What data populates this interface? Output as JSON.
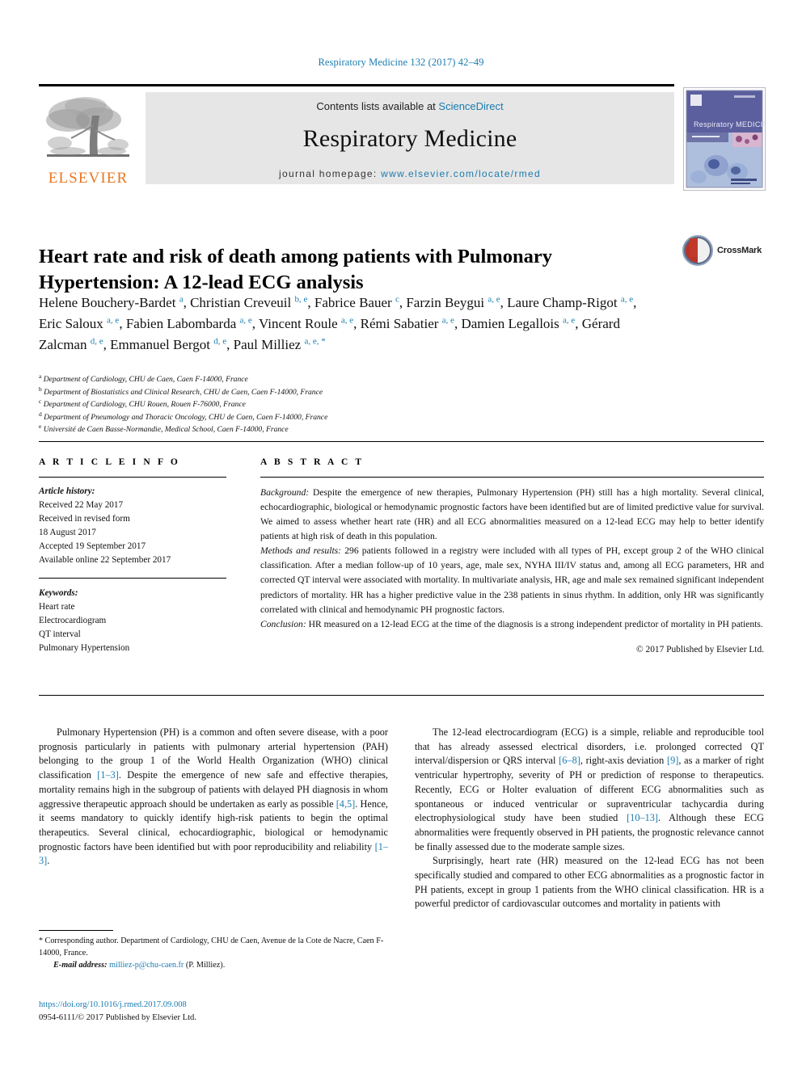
{
  "running_head": "Respiratory Medicine 132 (2017) 42–49",
  "masthead": {
    "contents_prefix": "Contents lists available at ",
    "sciencedirect": "ScienceDirect",
    "journal_name": "Respiratory Medicine",
    "homepage_prefix": "journal homepage: ",
    "homepage_url": "www.elsevier.com/locate/rmed",
    "publisher": "ELSEVIER",
    "cover_title": "Respiratory MEDICINE"
  },
  "badge": {
    "label": "CrossMark"
  },
  "article": {
    "title": "Heart rate and risk of death among patients with Pulmonary Hypertension: A 12-lead ECG analysis",
    "authors": [
      {
        "name": "Helene Bouchery-Bardet",
        "aff": "a",
        "sep": ", "
      },
      {
        "name": "Christian Creveuil",
        "aff": "b, e",
        "sep": ", "
      },
      {
        "name": "Fabrice Bauer",
        "aff": "c",
        "sep": ", "
      },
      {
        "name": "Farzin Beygui",
        "aff": "a, e",
        "sep": ", "
      },
      {
        "name": "Laure Champ-Rigot",
        "aff": "a, e",
        "sep": ", "
      },
      {
        "name": "Eric Saloux",
        "aff": "a, e",
        "sep": ", "
      },
      {
        "name": "Fabien Labombarda",
        "aff": "a, e",
        "sep": ", "
      },
      {
        "name": "Vincent Roule",
        "aff": "a, e",
        "sep": ", "
      },
      {
        "name": "Rémi Sabatier",
        "aff": "a, e",
        "sep": ", "
      },
      {
        "name": "Damien Legallois",
        "aff": "a, e",
        "sep": ", "
      },
      {
        "name": "Gérard Zalcman",
        "aff": "d, e",
        "sep": ", "
      },
      {
        "name": "Emmanuel Bergot",
        "aff": "d, e",
        "sep": ", "
      },
      {
        "name": "Paul Milliez",
        "aff": "a, e, *",
        "sep": ""
      }
    ],
    "affiliations": [
      {
        "mark": "a",
        "text": "Department of Cardiology, CHU de Caen, Caen F-14000, France"
      },
      {
        "mark": "b",
        "text": "Department of Biostatistics and Clinical Research, CHU de Caen, Caen F-14000, France"
      },
      {
        "mark": "c",
        "text": "Department of Cardiology, CHU Rouen, Rouen F-76000, France"
      },
      {
        "mark": "d",
        "text": "Department of Pneumology and Thoracic Oncology, CHU de Caen, Caen F-14000, France"
      },
      {
        "mark": "e",
        "text": "Université de Caen Basse-Normandie, Medical School, Caen F-14000, France"
      }
    ]
  },
  "article_info": {
    "heading": "A R T I C L E   I N F O",
    "history_label": "Article history:",
    "history": [
      "Received 22 May 2017",
      "Received in revised form",
      "18 August 2017",
      "Accepted 19 September 2017",
      "Available online 22 September 2017"
    ],
    "keywords_label": "Keywords:",
    "keywords": [
      "Heart rate",
      "Electrocardiogram",
      "QT interval",
      "Pulmonary Hypertension"
    ]
  },
  "abstract": {
    "heading": "A B S T R A C T",
    "background_label": "Background:",
    "background_text": " Despite the emergence of new therapies, Pulmonary Hypertension (PH) still has a high mortality. Several clinical, echocardiographic, biological or hemodynamic prognostic factors have been identified but are of limited predictive value for survival. We aimed to assess whether heart rate (HR) and all ECG abnormalities measured on a 12-lead ECG may help to better identify patients at high risk of death in this population.",
    "methods_label": "Methods and results:",
    "methods_text": "  296 patients followed in a registry were included with all types of PH, except group 2 of the WHO clinical classification. After a median follow-up of 10 years, age, male sex, NYHA III/IV status and, among all ECG parameters, HR and corrected QT interval were associated with mortality. In multivariate analysis, HR, age and male sex remained significant independent predictors of mortality. HR has a higher predictive value in the 238 patients in sinus rhythm. In addition, only HR was significantly correlated with clinical and hemodynamic PH prognostic factors.",
    "conclusion_label": "Conclusion:",
    "conclusion_text": " HR measured on a 12-lead ECG at the time of the diagnosis is a strong independent predictor of mortality in PH patients.",
    "copyright": "© 2017 Published by Elsevier Ltd."
  },
  "body": {
    "left": {
      "p1_a": "Pulmonary Hypertension (PH) is a common and often severe disease, with a poor prognosis particularly in patients with pulmonary arterial hypertension (PAH) belonging to the group 1 of the World Health Organization (WHO) clinical classification ",
      "ref1": "[1–3]",
      "p1_b": ". Despite the emergence of new safe and effective therapies, mortality remains high in the subgroup of patients with delayed PH diagnosis in whom aggressive therapeutic approach should be undertaken as early as possible ",
      "ref2": "[4,5]",
      "p1_c": ". Hence, it seems mandatory to quickly identify high-risk patients to begin the optimal therapeutics. Several clinical, echocardiographic, biological or hemodynamic prognostic factors have been identified but with poor reproducibility and reliability ",
      "ref3": "[1–3]",
      "p1_d": "."
    },
    "right": {
      "p1_a": "The 12-lead electrocardiogram (ECG) is a simple, reliable and reproducible tool that has already assessed electrical disorders, i.e. prolonged corrected QT interval/dispersion or QRS interval ",
      "ref1": "[6–8]",
      "p1_b": ", right-axis deviation ",
      "ref2": "[9]",
      "p1_c": ", as a marker of right ventricular hypertrophy, severity of PH or prediction of response to therapeutics. Recently, ECG or Holter evaluation of different ECG abnormalities such as spontaneous or induced ventricular or supraventricular tachycardia during electrophysiological study have been studied ",
      "ref3": "[10–13]",
      "p1_d": ". Although these ECG abnormalities were frequently observed in PH patients, the prognostic relevance cannot be finally assessed due to the moderate sample sizes.",
      "p2": "Surprisingly, heart rate (HR) measured on the 12-lead ECG has not been specifically studied and compared to other ECG abnormalities as a prognostic factor in PH patients, except in group 1 patients from the WHO clinical classification. HR is a powerful predictor of cardiovascular outcomes and mortality in patients with"
    }
  },
  "footnotes": {
    "corresponding_star": "*",
    "corresponding_text": " Corresponding author. Department of Cardiology, CHU de Caen, Avenue de la Cote de Nacre, Caen F-14000, France.",
    "email_label": "E-mail address:",
    "email": "milliez-p@chu-caen.fr",
    "email_suffix": " (P. Milliez)."
  },
  "imprint": {
    "doi": "https://doi.org/10.1016/j.rmed.2017.09.008",
    "issn_line": "0954-6111/© 2017 Published by Elsevier Ltd."
  },
  "colors": {
    "link": "#1a7bb0",
    "elsevier_orange": "#e87722",
    "band_gray": "#e6e6e6",
    "cover_purple": "#5b5f9e"
  }
}
